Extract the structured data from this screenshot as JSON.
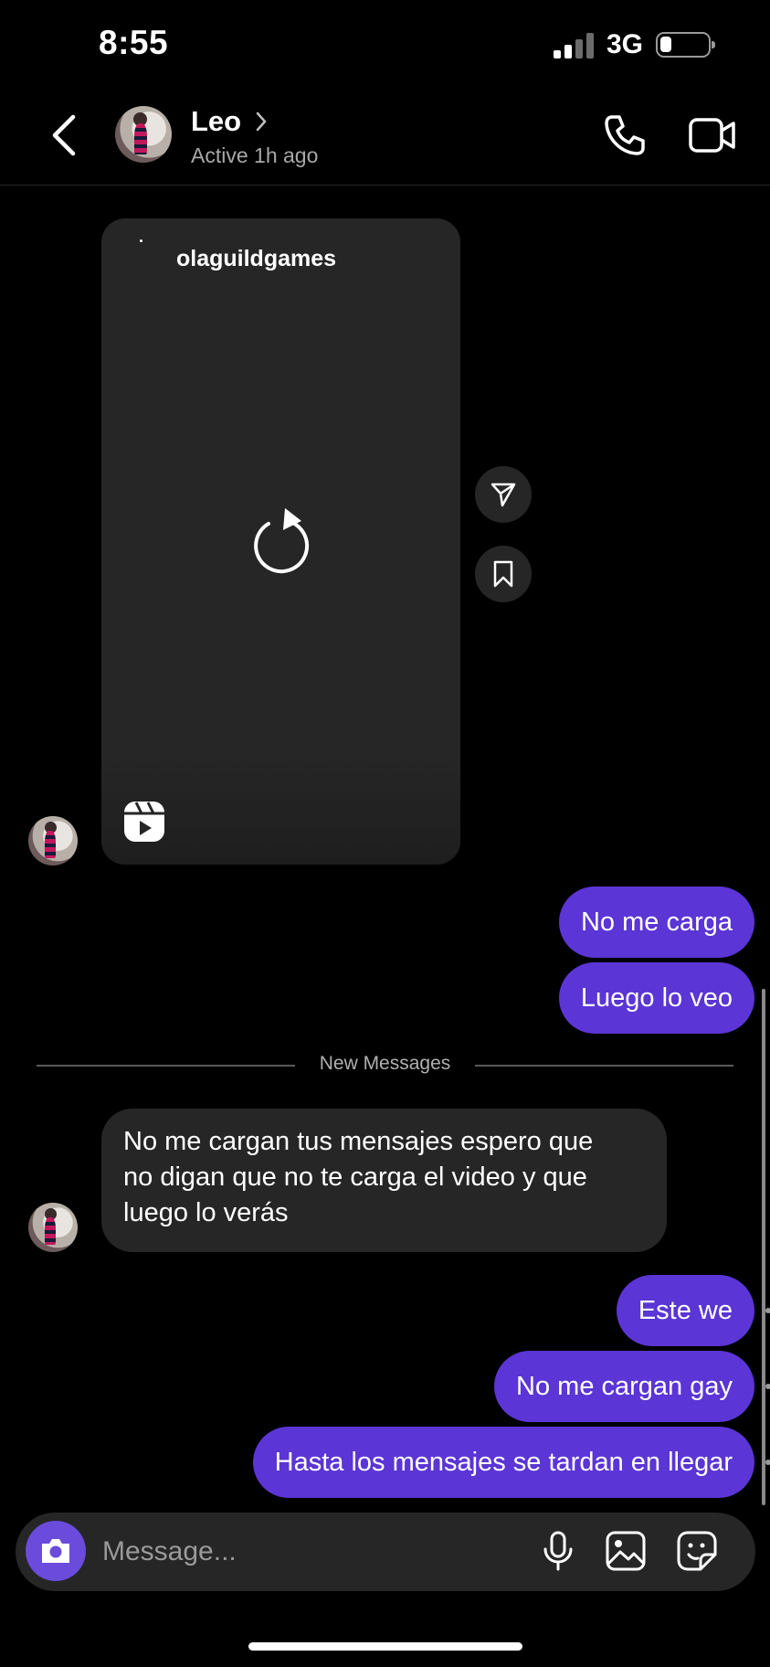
{
  "status_bar": {
    "time": "8:55",
    "network": "3G"
  },
  "header": {
    "name": "Leo",
    "status": "Active 1h ago"
  },
  "reel": {
    "username": "olaguildgames"
  },
  "messages": {
    "out1": "No me carga",
    "out2": "Luego lo veo",
    "new_messages_label": "New Messages",
    "in_line1": "No me cargan tus mensajes espero que",
    "in_line2": "no digan que no te carga el video y que",
    "in_line3": "luego lo verás",
    "out3": "Este we",
    "out4": "No me cargan gay",
    "out5": "Hasta los mensajes se tardan en llegar"
  },
  "composer": {
    "placeholder": "Message..."
  },
  "colors": {
    "outgoing_bubble": "#5b35d5",
    "incoming_bubble": "#262626",
    "camera_button": "#6a4bdc"
  }
}
